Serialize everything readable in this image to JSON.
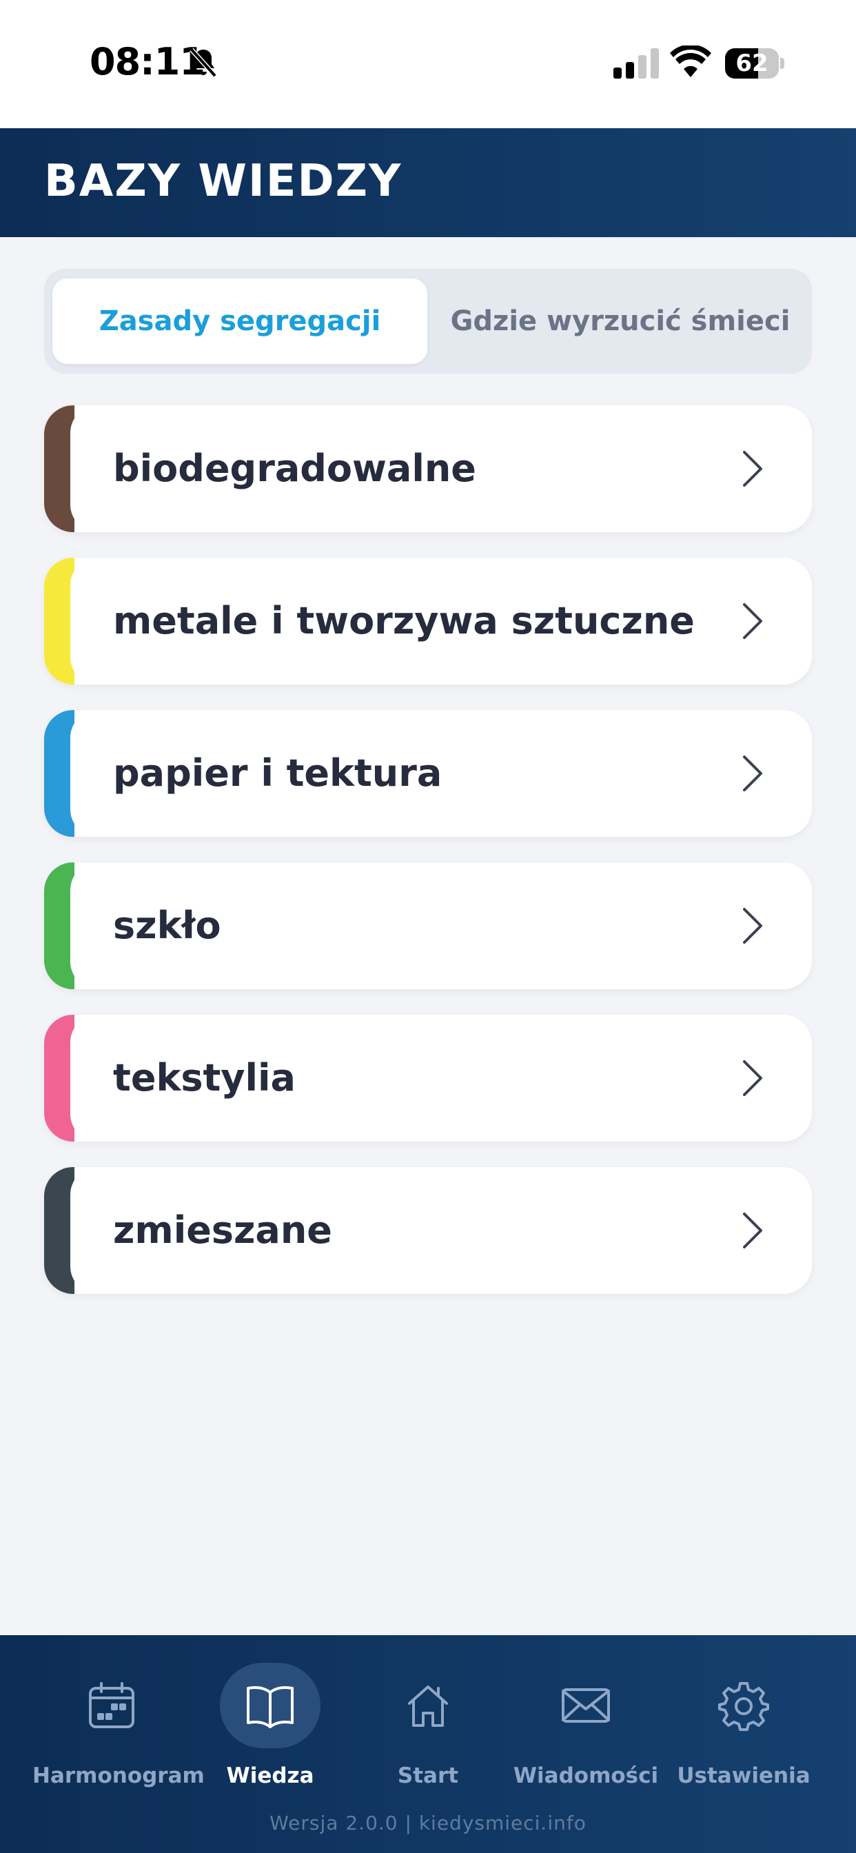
{
  "status_bar": {
    "time": "08:11",
    "battery_level": "62",
    "battery_fraction": 0.62
  },
  "header": {
    "title": "BAZY WIEDZY"
  },
  "segments": {
    "active": "Zasady segregacji",
    "inactive": "Gdzie wyrzucić śmieci"
  },
  "categories": [
    {
      "label": "biodegradowalne",
      "color": "#6b4a3e"
    },
    {
      "label": "metale i tworzywa sztuczne",
      "color": "#f7e93c"
    },
    {
      "label": "papier i tektura",
      "color": "#2b9ad8"
    },
    {
      "label": "szkło",
      "color": "#4bb552"
    },
    {
      "label": "tekstylia",
      "color": "#f06494"
    },
    {
      "label": "zmieszane",
      "color": "#3a474f"
    }
  ],
  "nav": {
    "items": [
      {
        "label": "Harmonogram",
        "icon": "calendar-icon"
      },
      {
        "label": "Wiedza",
        "icon": "book-icon",
        "active": true
      },
      {
        "label": "Start",
        "icon": "home-icon"
      },
      {
        "label": "Wiadomości",
        "icon": "mail-icon"
      },
      {
        "label": "Ustawienia",
        "icon": "gear-icon"
      }
    ],
    "version": "Wersja 2.0.0 | kiedysmieci.info"
  }
}
